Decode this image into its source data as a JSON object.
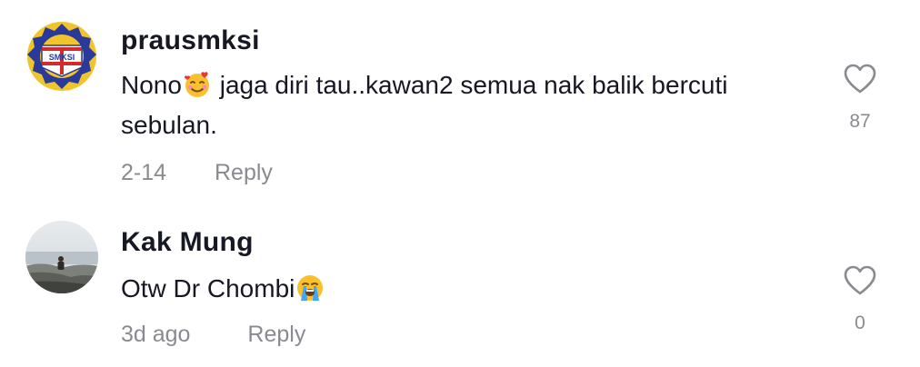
{
  "comments": [
    {
      "username": "prausmksi",
      "text_before": "Nono",
      "emoji": "smiling-face-with-hearts",
      "text_after": " jaga diri tau..kawan2 semua nak balik bercuti sebulan.",
      "date": "2-14",
      "reply_label": "Reply",
      "likes": "87",
      "avatar_text": "SMKSI"
    },
    {
      "username": "Kak Mung",
      "text_before": "Otw Dr Chombi",
      "emoji": "loudly-crying-face",
      "text_after": "",
      "date": "3d ago",
      "reply_label": "Reply",
      "likes": "0"
    }
  ],
  "colors": {
    "text": "#161823",
    "muted": "#8a8b91",
    "badge_blue": "#2a3a9a",
    "badge_yellow": "#f2c42b",
    "badge_red": "#d42a2a"
  }
}
